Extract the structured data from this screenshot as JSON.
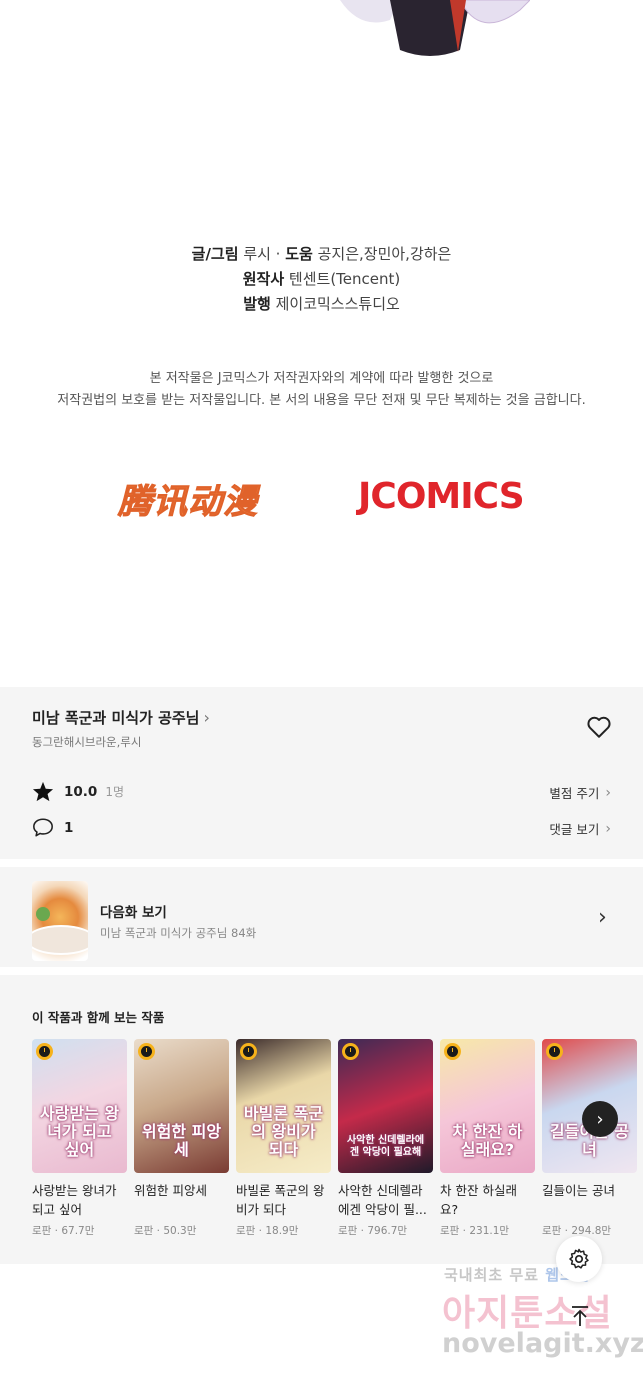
{
  "credits": {
    "line1_label": "글/그림",
    "line1_value": "루시 · ",
    "line1_label2": "도움",
    "line1_value2": "공지은,장민아,강하은",
    "line2_label": "원작사",
    "line2_value": "텐센트(Tencent)",
    "line3_label": "발행",
    "line3_value": "제이코믹스스튜디오"
  },
  "notice": {
    "line1": "본 저작물은 J코믹스가 저작권자와의 계약에 따라 발행한 것으로",
    "line2": "저작권법의 보호를 받는 저작물입니다. 본 서의 내용을 무단 전재 및 무단 복제하는 것을 금합니다."
  },
  "logos": {
    "tencent": "腾讯动漫",
    "jcomics": "JCOMICS"
  },
  "work": {
    "title": "미남 폭군과 미식가 공주님",
    "authors": "동그란해시브라운,루시",
    "rating": "10.0",
    "rating_count": "1명",
    "rate_link": "별점 주기",
    "comment_count": "1",
    "comment_link": "댓글 보기"
  },
  "next_episode": {
    "label": "다음화 보기",
    "subtitle": "미남 폭군과 미식가 공주님 84화"
  },
  "recommend": {
    "heading": "이 작품과 함께 보는 작품",
    "items": [
      {
        "name": "사랑받는 왕녀가 되고 싶어",
        "meta": "로판 · 67.7만",
        "cover_text": "사랑받는 왕녀가 되고 싶어"
      },
      {
        "name": "위험한 피앙세",
        "meta": "로판 · 50.3만",
        "cover_text": "위험한 피앙세"
      },
      {
        "name": "바빌론 폭군의 왕비가 되다",
        "meta": "로판 · 18.9만",
        "cover_text": "바빌론 폭군의 왕비가 되다"
      },
      {
        "name": "사악한 신데렐라에겐 악당이 필...",
        "meta": "로판 · 796.7만",
        "cover_text": "사악한 신데렐라에겐 악당이 필요해"
      },
      {
        "name": "차 한잔 하실래요?",
        "meta": "로판 · 231.1만",
        "cover_text": "차 한잔 하실래요?"
      },
      {
        "name": "길들이는 공녀",
        "meta": "로판 · 294.8만",
        "cover_text": "길들이는 공녀"
      }
    ]
  },
  "watermark": {
    "line1a": "국내최초 무료 ",
    "line1b": "웹소설",
    "line2": "아지툰소설",
    "line3": "novelagit.xyz"
  },
  "colors": {
    "accent_tencent": "#f07a3a",
    "accent_jcomics": "#e0252b",
    "clock_badge": "#f6b21b",
    "panel_bg": "#f5f5f5"
  },
  "icons": [
    "star-icon",
    "comment-icon",
    "heart-icon",
    "chevron-right-icon",
    "clock-icon",
    "settings-icon",
    "arrow-up-icon"
  ]
}
